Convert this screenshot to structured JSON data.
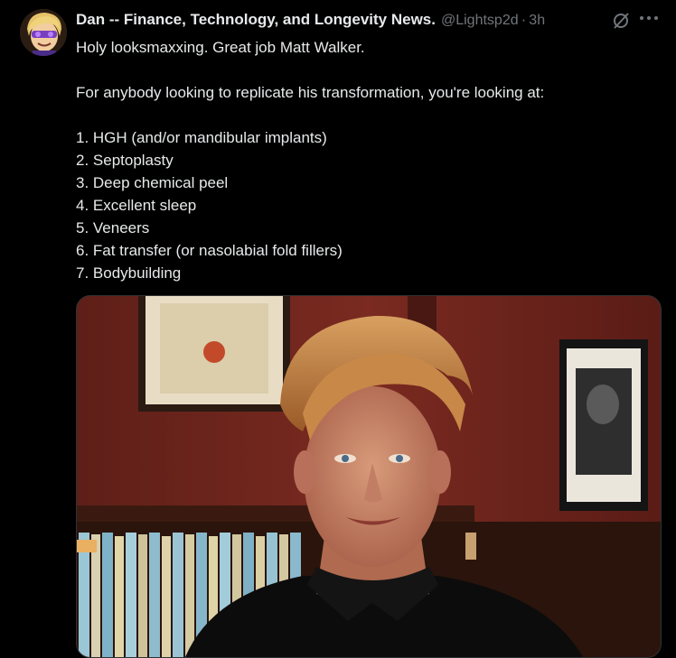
{
  "author": {
    "name": "Dan -- Finance, Technology, and Longevity News.",
    "handle": "@Lightsp2d",
    "separator": "·",
    "time": "3h"
  },
  "icons": {
    "avatar": "cartoon-avatar",
    "grok": "grok-icon",
    "more": "more-icon"
  },
  "tweet": {
    "line1": "Holy looksmaxxing.  Great job Matt Walker.",
    "line2": "For anybody looking to replicate his transformation, you're looking at:",
    "items": [
      "1. HGH (and/or mandibular implants)",
      "2. Septoplasty",
      "3. Deep chemical peel",
      "4. Excellent sleep",
      "5. Veneers",
      "6. Fat transfer (or nasolabial fold fillers)",
      "7. Bodybuilding"
    ]
  },
  "colors": {
    "background": "#000000",
    "text": "#e7e9ea",
    "muted": "#71767b"
  }
}
